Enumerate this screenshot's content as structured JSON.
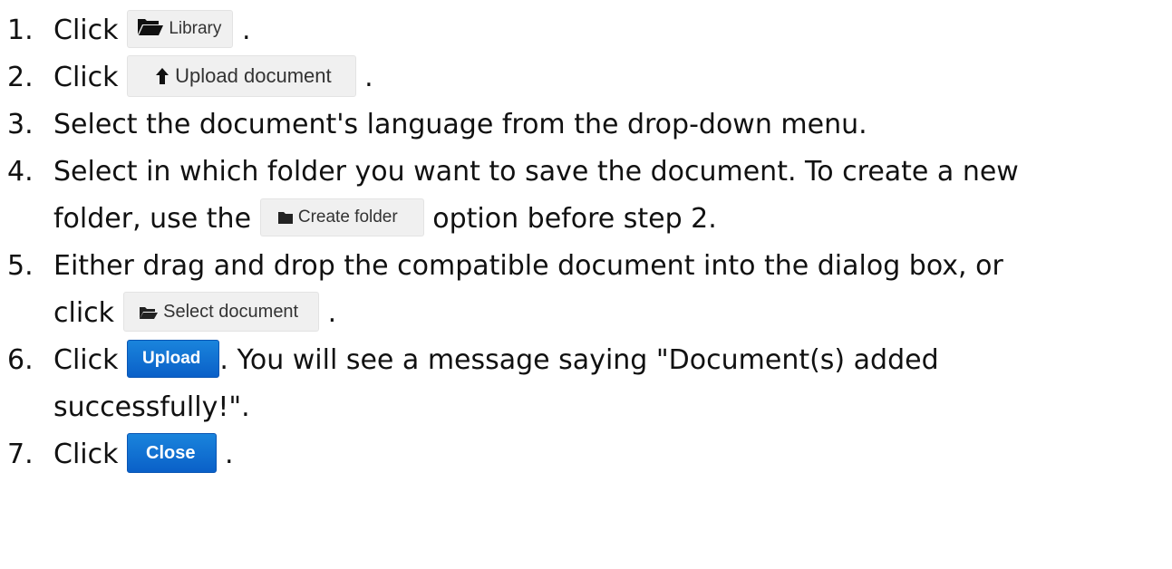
{
  "steps": [
    {
      "num": "1.",
      "pre": "Click ",
      "btn": "Library",
      "post": " ."
    },
    {
      "num": "2.",
      "pre": "Click ",
      "btn": "Upload document",
      "post": " ."
    },
    {
      "num": "3.",
      "text": "Select the document's language from the drop-down menu."
    },
    {
      "num": "4.",
      "line1": "Select in which folder you want to save the document. To create a new",
      "pre": "folder, use the ",
      "btn": "Create folder",
      "post": " option before step 2."
    },
    {
      "num": "5.",
      "line1": "Either drag and drop the compatible document into the dialog box, or",
      "pre": "click ",
      "btn": "Select document",
      "post": " ."
    },
    {
      "num": "6.",
      "pre": "Click ",
      "btn": "Upload",
      "post": ". You will see a message saying \"Document(s) added",
      "line2": "successfully!\"."
    },
    {
      "num": "7.",
      "pre": "Click ",
      "btn": "Close",
      "post": " ."
    }
  ],
  "icons": {
    "library": "folder-open-icon",
    "upload": "arrow-up-icon",
    "create_folder": "folder-icon",
    "select_document": "folder-open-icon"
  },
  "colors": {
    "primary_button": "#0a6fd6",
    "light_button": "#f0f0f0"
  }
}
